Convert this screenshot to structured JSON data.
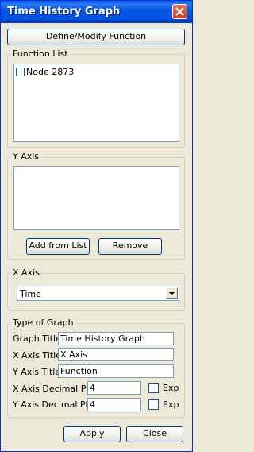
{
  "window": {
    "title": "Time History Graph",
    "close_icon": "close-icon"
  },
  "define_button": "Define/Modify Function",
  "function_list": {
    "label": "Function List",
    "items": [
      {
        "label": "Node 2873",
        "checked": false
      }
    ]
  },
  "y_axis": {
    "label": "Y Axis",
    "items": [],
    "add_button": "Add from List",
    "remove_button": "Remove"
  },
  "x_axis": {
    "label": "X Axis",
    "selected": "Time",
    "arrow_icon": "chevron-down-icon"
  },
  "type_of_graph": {
    "label": "Type of Graph",
    "graph_title_label": "Graph Title",
    "graph_title_value": "Time History Graph",
    "x_axis_title_label": "X Axis Title",
    "x_axis_title_value": "X Axis",
    "y_axis_title_label": "Y Axis Title",
    "y_axis_title_value": "Function",
    "x_decimal_label": "X Axis Decimal Pt.",
    "x_decimal_value": "4",
    "y_decimal_label": "Y Axis Decimal Pt.",
    "y_decimal_value": "4",
    "exp_label": "Exp",
    "x_exp_checked": false,
    "y_exp_checked": false
  },
  "footer": {
    "apply_button": "Apply",
    "close_button": "Close"
  }
}
